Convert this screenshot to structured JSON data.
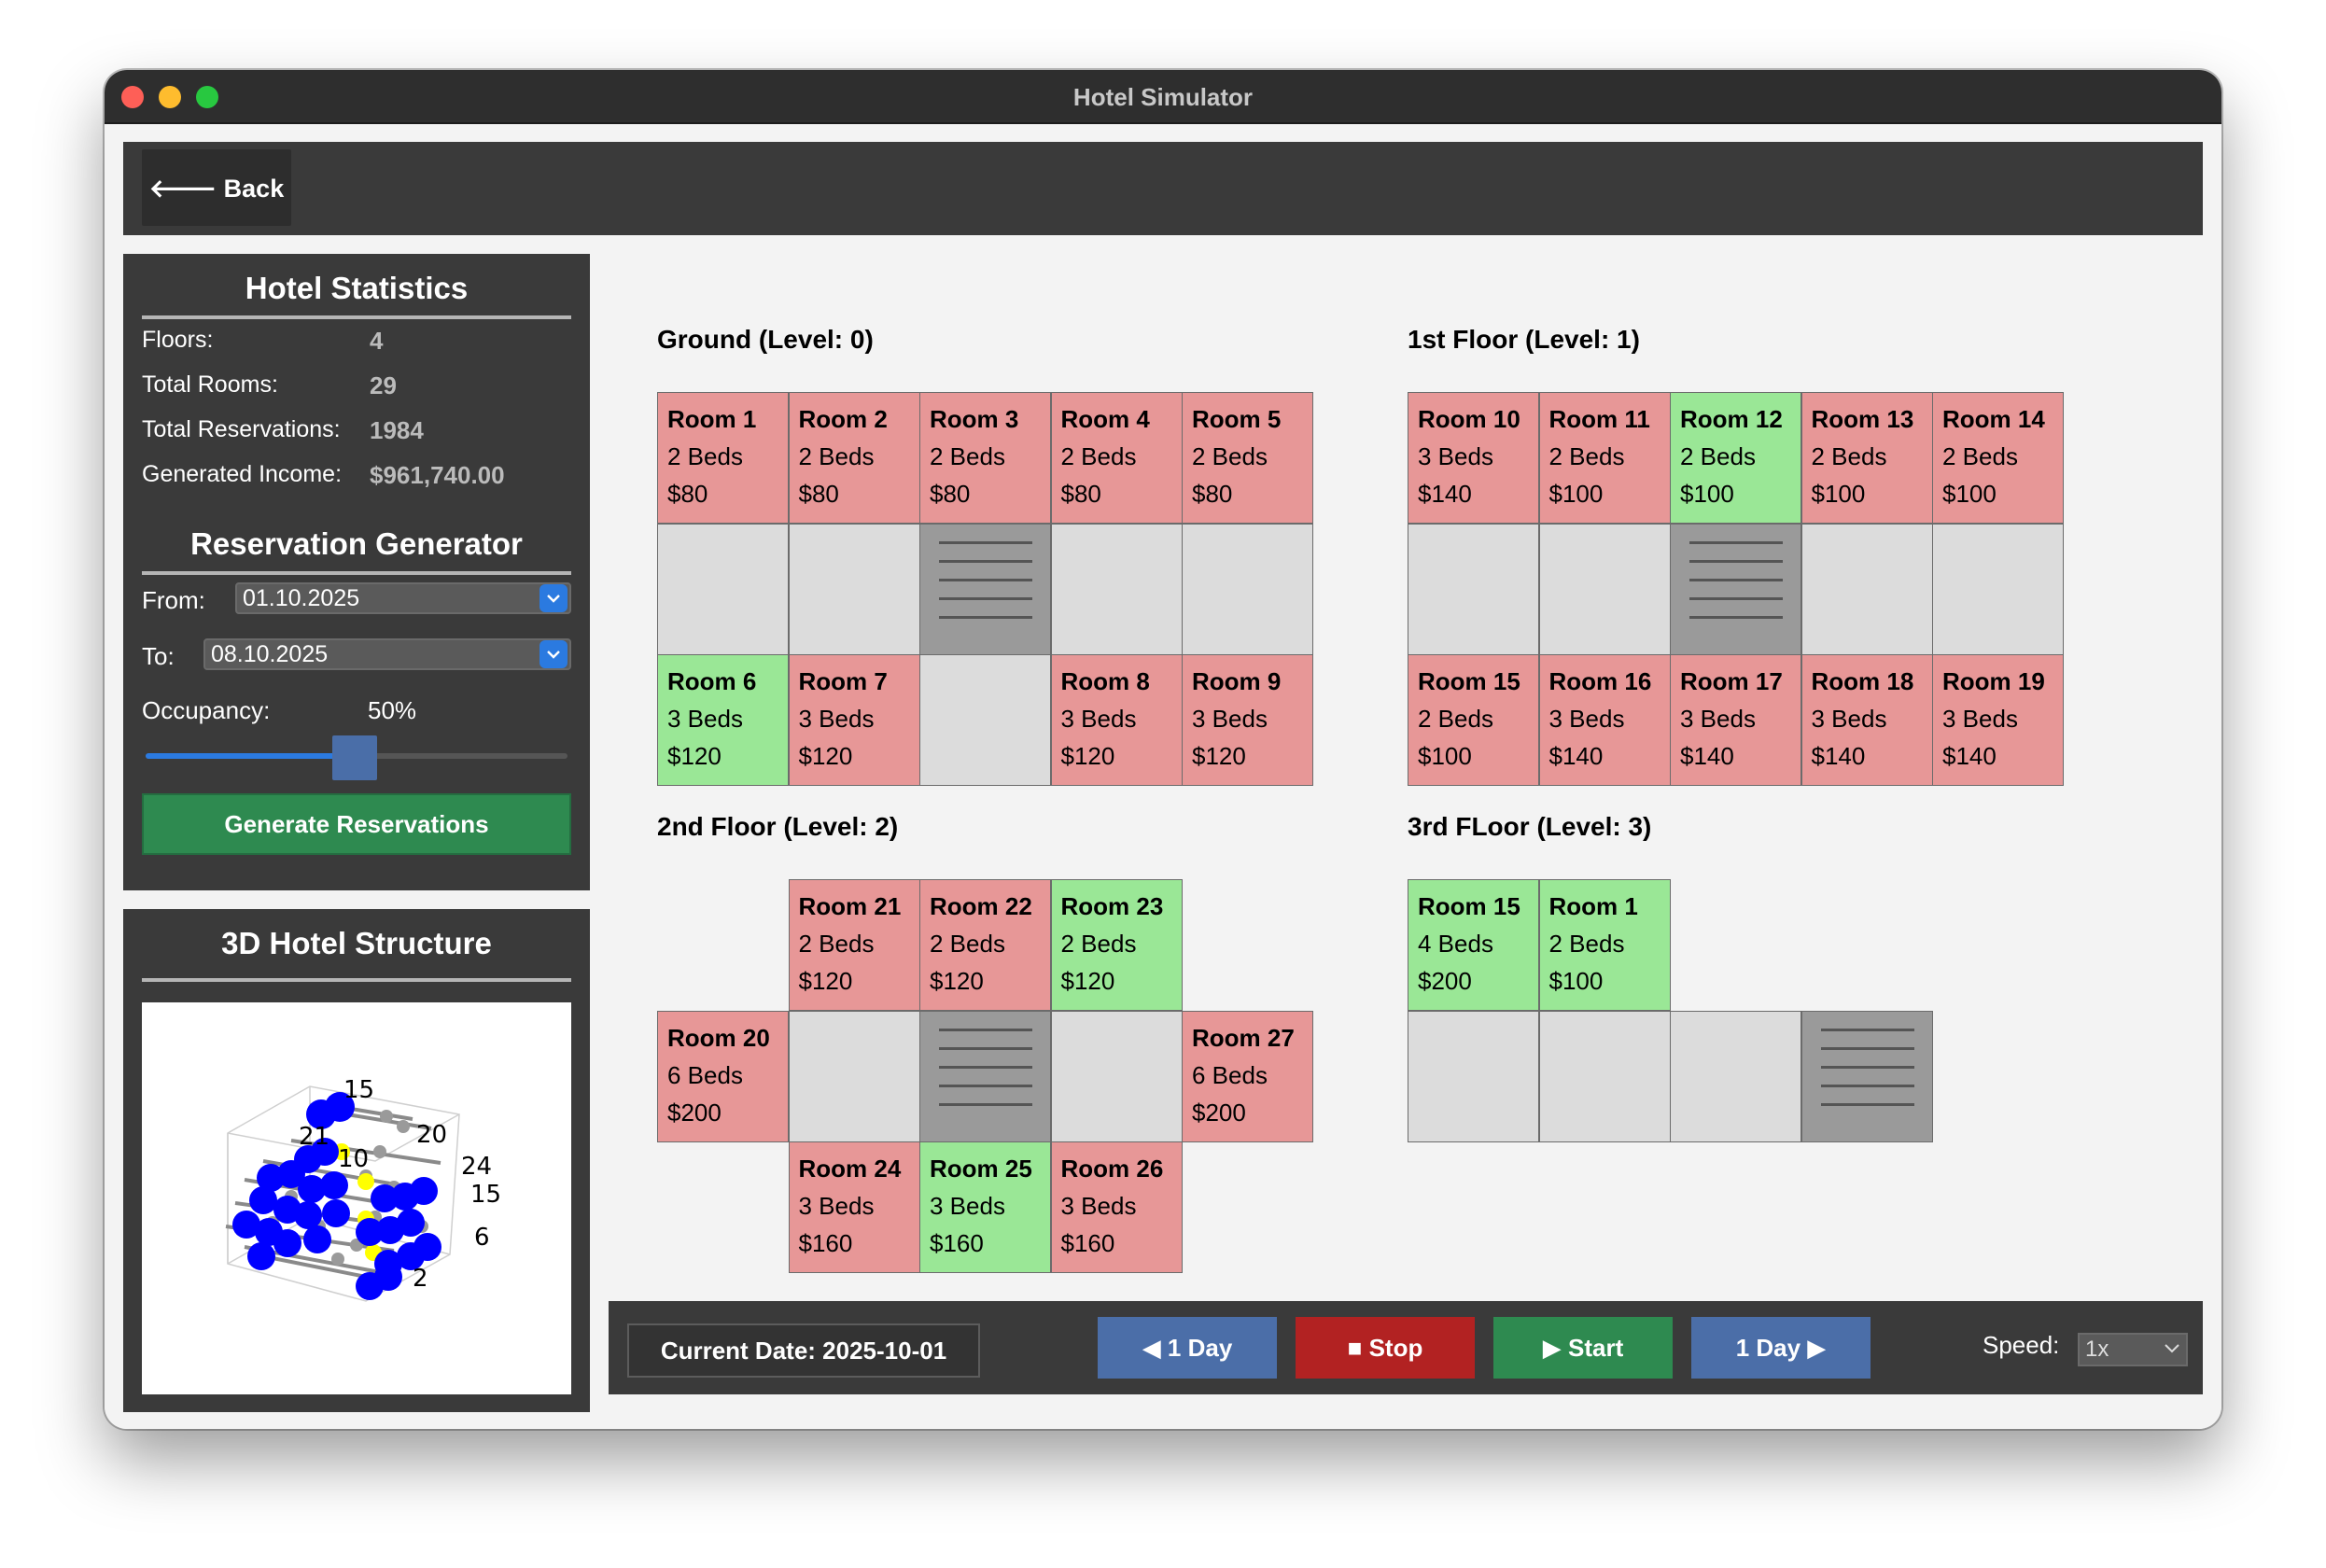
{
  "window": {
    "title": "Hotel Simulator"
  },
  "topbar": {
    "back_label": "🡐 Back"
  },
  "stats": {
    "title": "Hotel Statistics",
    "rows": [
      {
        "label": "Floors:",
        "value": "4"
      },
      {
        "label": "Total Rooms:",
        "value": "29"
      },
      {
        "label": "Total Reservations:",
        "value": "1984"
      },
      {
        "label": "Generated Income:",
        "value": "$961,740.00"
      }
    ]
  },
  "generator": {
    "title": "Reservation Generator",
    "from_label": "From:",
    "from_value": "01.10.2025",
    "to_label": "To:",
    "to_value": "08.10.2025",
    "occupancy_label": "Occupancy:",
    "occupancy_value": "50%",
    "occupancy_fraction": 0.5,
    "button_label": "Generate Reservations",
    "dropdown_icon": "chevron-down-icon"
  },
  "structure": {
    "title": "3D Hotel Structure",
    "tick_labels": [
      "15",
      "21",
      "20",
      "10",
      "24",
      "15",
      "2",
      "6"
    ]
  },
  "floors": [
    {
      "title": "Ground (Level: 0)",
      "cells": [
        {
          "type": "occupied",
          "name": "Room 1",
          "beds": "2 Beds",
          "price": "$80"
        },
        {
          "type": "occupied",
          "name": "Room 2",
          "beds": "2 Beds",
          "price": "$80"
        },
        {
          "type": "occupied",
          "name": "Room 3",
          "beds": "2 Beds",
          "price": "$80"
        },
        {
          "type": "occupied",
          "name": "Room 4",
          "beds": "2 Beds",
          "price": "$80"
        },
        {
          "type": "occupied",
          "name": "Room 5",
          "beds": "2 Beds",
          "price": "$80"
        },
        {
          "type": "empty"
        },
        {
          "type": "empty"
        },
        {
          "type": "stairs"
        },
        {
          "type": "empty"
        },
        {
          "type": "empty"
        },
        {
          "type": "free",
          "name": "Room 6",
          "beds": "3 Beds",
          "price": "$120"
        },
        {
          "type": "occupied",
          "name": "Room 7",
          "beds": "3 Beds",
          "price": "$120"
        },
        {
          "type": "empty"
        },
        {
          "type": "occupied",
          "name": "Room 8",
          "beds": "3 Beds",
          "price": "$120"
        },
        {
          "type": "occupied",
          "name": "Room 9",
          "beds": "3 Beds",
          "price": "$120"
        }
      ]
    },
    {
      "title": "1st Floor (Level: 1)",
      "cells": [
        {
          "type": "occupied",
          "name": "Room 10",
          "beds": "3 Beds",
          "price": "$140"
        },
        {
          "type": "occupied",
          "name": "Room 11",
          "beds": "2 Beds",
          "price": "$100"
        },
        {
          "type": "free",
          "name": "Room 12",
          "beds": "2 Beds",
          "price": "$100"
        },
        {
          "type": "occupied",
          "name": "Room 13",
          "beds": "2 Beds",
          "price": "$100"
        },
        {
          "type": "occupied",
          "name": "Room 14",
          "beds": "2 Beds",
          "price": "$100"
        },
        {
          "type": "empty"
        },
        {
          "type": "empty"
        },
        {
          "type": "stairs"
        },
        {
          "type": "empty"
        },
        {
          "type": "empty"
        },
        {
          "type": "occupied",
          "name": "Room 15",
          "beds": "2 Beds",
          "price": "$100"
        },
        {
          "type": "occupied",
          "name": "Room 16",
          "beds": "3 Beds",
          "price": "$140"
        },
        {
          "type": "occupied",
          "name": "Room 17",
          "beds": "3 Beds",
          "price": "$140"
        },
        {
          "type": "occupied",
          "name": "Room 18",
          "beds": "3 Beds",
          "price": "$140"
        },
        {
          "type": "occupied",
          "name": "Room 19",
          "beds": "3 Beds",
          "price": "$140"
        }
      ]
    },
    {
      "title": "2nd Floor (Level: 2)",
      "cells": [
        {
          "type": "none"
        },
        {
          "type": "occupied",
          "name": "Room 21",
          "beds": "2 Beds",
          "price": "$120"
        },
        {
          "type": "occupied",
          "name": "Room 22",
          "beds": "2 Beds",
          "price": "$120"
        },
        {
          "type": "free",
          "name": "Room 23",
          "beds": "2 Beds",
          "price": "$120"
        },
        {
          "type": "none"
        },
        {
          "type": "occupied",
          "name": "Room 20",
          "beds": "6 Beds",
          "price": "$200"
        },
        {
          "type": "empty"
        },
        {
          "type": "stairs"
        },
        {
          "type": "empty"
        },
        {
          "type": "occupied",
          "name": "Room 27",
          "beds": "6 Beds",
          "price": "$200"
        },
        {
          "type": "none"
        },
        {
          "type": "occupied",
          "name": "Room 24",
          "beds": "3 Beds",
          "price": "$160"
        },
        {
          "type": "free",
          "name": "Room 25",
          "beds": "3 Beds",
          "price": "$160"
        },
        {
          "type": "occupied",
          "name": "Room 26",
          "beds": "3 Beds",
          "price": "$160"
        },
        {
          "type": "none"
        }
      ]
    },
    {
      "title": "3rd FLoor (Level: 3)",
      "cells": [
        {
          "type": "free",
          "name": "Room 15",
          "beds": "4 Beds",
          "price": "$200"
        },
        {
          "type": "free",
          "name": "Room 1",
          "beds": "2 Beds",
          "price": "$100"
        },
        {
          "type": "none"
        },
        {
          "type": "none"
        },
        {
          "type": "none"
        },
        {
          "type": "empty"
        },
        {
          "type": "empty"
        },
        {
          "type": "empty"
        },
        {
          "type": "stairs"
        },
        {
          "type": "none"
        }
      ]
    }
  ],
  "colors": {
    "occupied": "#e79797",
    "free": "#9ae796",
    "empty": "#dcdcdc",
    "stairs": "#9a9a9a"
  },
  "controls": {
    "current_date": "Current Date: 2025-10-01",
    "prev_day": "◀ 1 Day",
    "stop": "■ Stop",
    "start": "▶ Start",
    "next_day": "1 Day ▶",
    "speed_label": "Speed:",
    "speed_value": "1x"
  }
}
